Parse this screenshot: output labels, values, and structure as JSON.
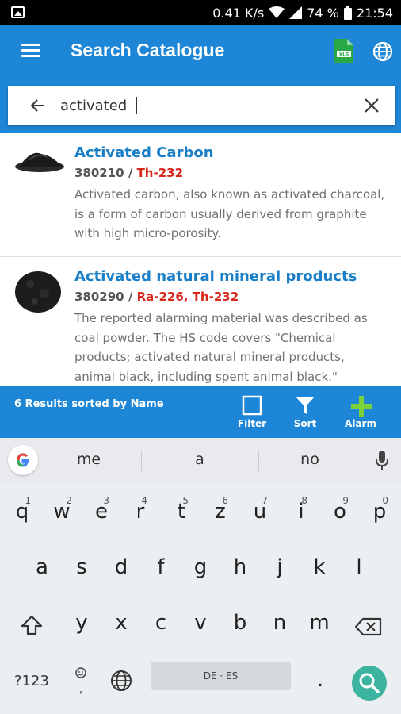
{
  "status_bar": {
    "speed": "0.41 K/s",
    "battery": "74 %",
    "time": "21:54"
  },
  "app_bar": {
    "title": "Search Catalogue"
  },
  "search": {
    "value": "activated",
    "placeholder": ""
  },
  "results": [
    {
      "title": "Activated Carbon",
      "code": "380210",
      "isotopes": "Th-232",
      "description": "Activated carbon, also known as activated charcoal, is a form of carbon usually derived from graphite with high micro-porosity."
    },
    {
      "title": "Activated natural mineral products",
      "code": "380290",
      "isotopes": "Ra-226, Th-232",
      "description": "The reported alarming material was described as coal powder. The HS code covers \"Chemical products; activated natural mineral products, animal black, including spent animal black.\""
    }
  ],
  "action_bar": {
    "summary": "6 Results sorted by Name",
    "filter_label": "Filter",
    "sort_label": "Sort",
    "alarm_label": "Alarm"
  },
  "keyboard": {
    "suggestions": [
      "me",
      "a",
      "no"
    ],
    "row1": [
      "q",
      "w",
      "e",
      "r",
      "t",
      "z",
      "u",
      "i",
      "o",
      "p"
    ],
    "row1_hints": [
      "1",
      "2",
      "3",
      "4",
      "5",
      "6",
      "7",
      "8",
      "9",
      "0"
    ],
    "row2": [
      "a",
      "s",
      "d",
      "f",
      "g",
      "h",
      "j",
      "k",
      "l"
    ],
    "row3": [
      "y",
      "x",
      "c",
      "v",
      "b",
      "n",
      "m"
    ],
    "symbols_label": "?123",
    "space_label": "DE · ES",
    "period": "."
  },
  "colors": {
    "primary": "#1d86d6",
    "title_blue": "#1a7fc7",
    "isotope_red": "#d8261b",
    "alarm_green": "#7bd23b",
    "search_key_teal": "#3cb4a0"
  }
}
